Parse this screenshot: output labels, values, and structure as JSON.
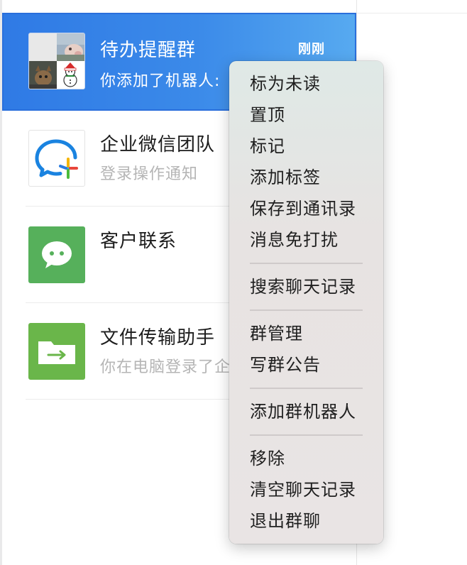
{
  "chats": [
    {
      "title": "待办提醒群",
      "subtitle": "你添加了机器人:",
      "time": "刚刚",
      "selected": true,
      "avatar": "group-avatar-grid"
    },
    {
      "title": "企业微信团队",
      "subtitle": "登录操作通知",
      "avatar": "wecom-logo"
    },
    {
      "title": "客户联系",
      "subtitle": "",
      "avatar": "wechat-chat-icon"
    },
    {
      "title": "文件传输助手",
      "subtitle": "你在电脑登录了企",
      "avatar": "folder-transfer-icon"
    }
  ],
  "context_menu": {
    "groups": [
      [
        "标为未读",
        "置顶",
        "标记",
        "添加标签",
        "保存到通讯录",
        "消息免打扰"
      ],
      [
        "搜索聊天记录"
      ],
      [
        "群管理",
        "写群公告"
      ],
      [
        "添加群机器人"
      ],
      [
        "移除",
        "清空聊天记录",
        "退出群聊"
      ]
    ]
  },
  "colors": {
    "selected_row": "#3b8ae9",
    "wechat_green": "#56b05b",
    "file_green": "#6ab64a",
    "menu_bg": "#e9e4e4"
  }
}
